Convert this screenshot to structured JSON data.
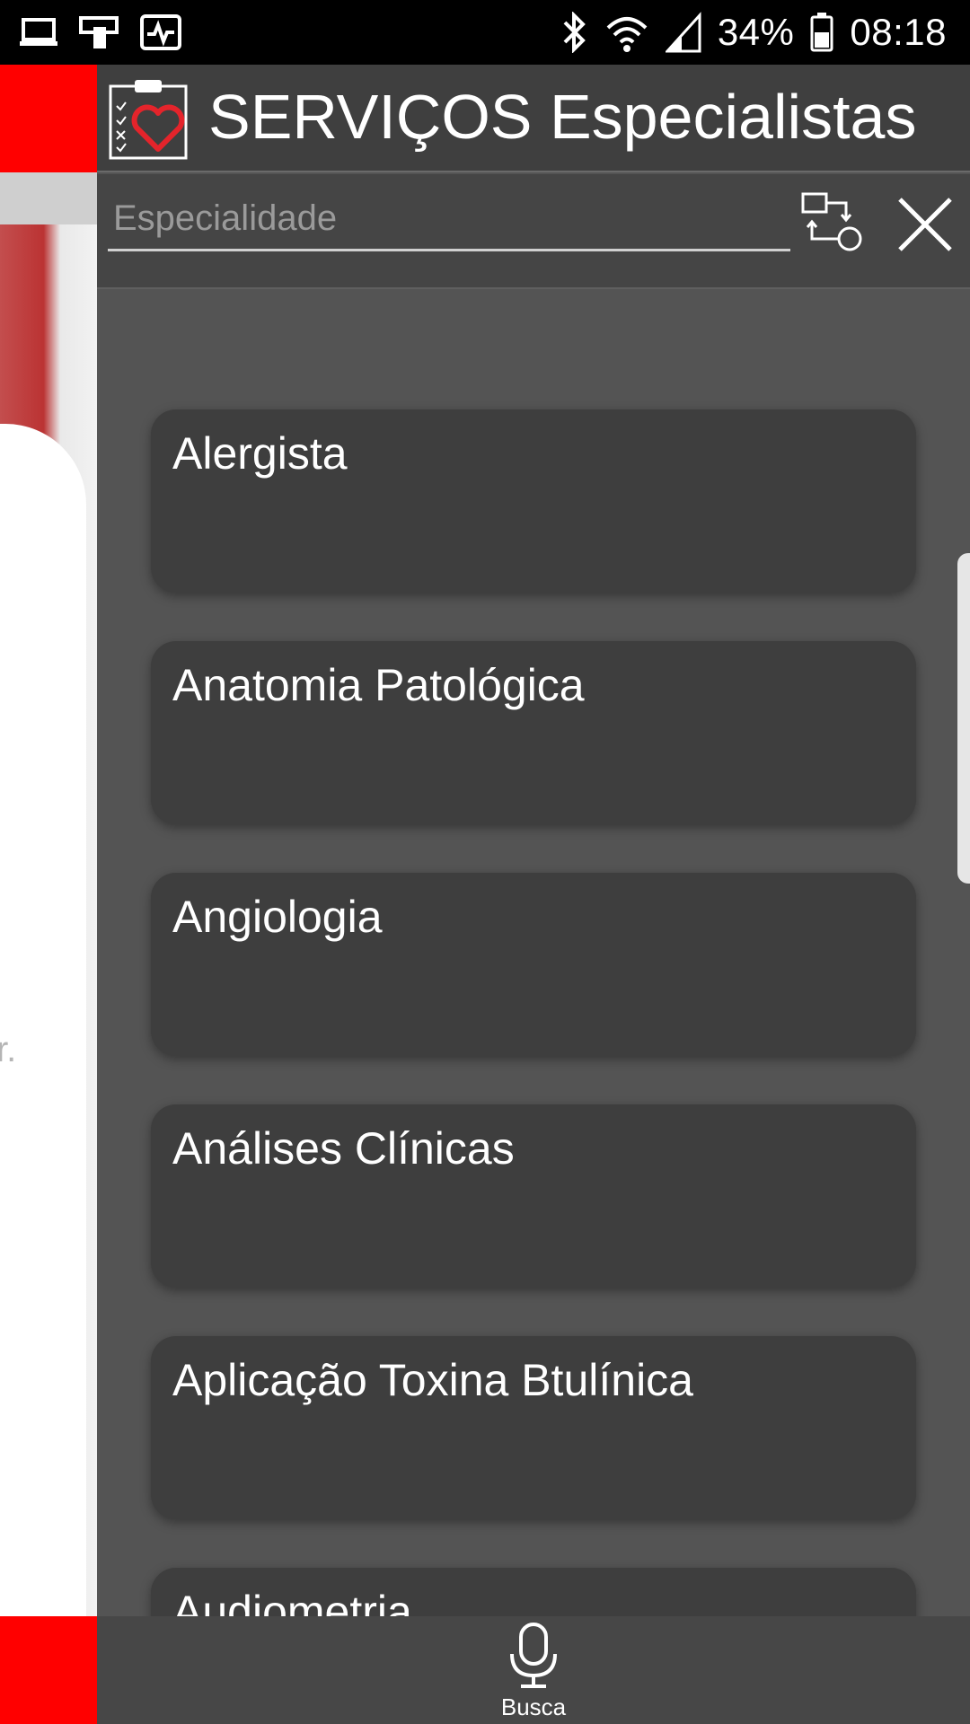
{
  "status_bar": {
    "battery": "34%",
    "time": "08:18"
  },
  "background": {
    "partial_text": "r."
  },
  "header": {
    "title": "SERVIÇOS Especialistas"
  },
  "search": {
    "placeholder": "Especialidade",
    "value": ""
  },
  "specialties": [
    "Alergista",
    "Anatomia Patológica",
    "Angiologia",
    "Análises Clínicas",
    "Aplicação Toxina Btulínica",
    "Audiometria"
  ],
  "bottom_bar": {
    "search_label": "Busca"
  },
  "colors": {
    "accent_red": "#ff0000",
    "drawer_bg": "#545454",
    "card_bg": "#3e3e3e",
    "header_bg": "#3f3f3f",
    "heart_red": "#e4242b"
  },
  "icons": {
    "header": "clipboard-heart-icon",
    "sort": "sort-swap-icon",
    "close": "close-icon",
    "search": "microphone-icon"
  }
}
